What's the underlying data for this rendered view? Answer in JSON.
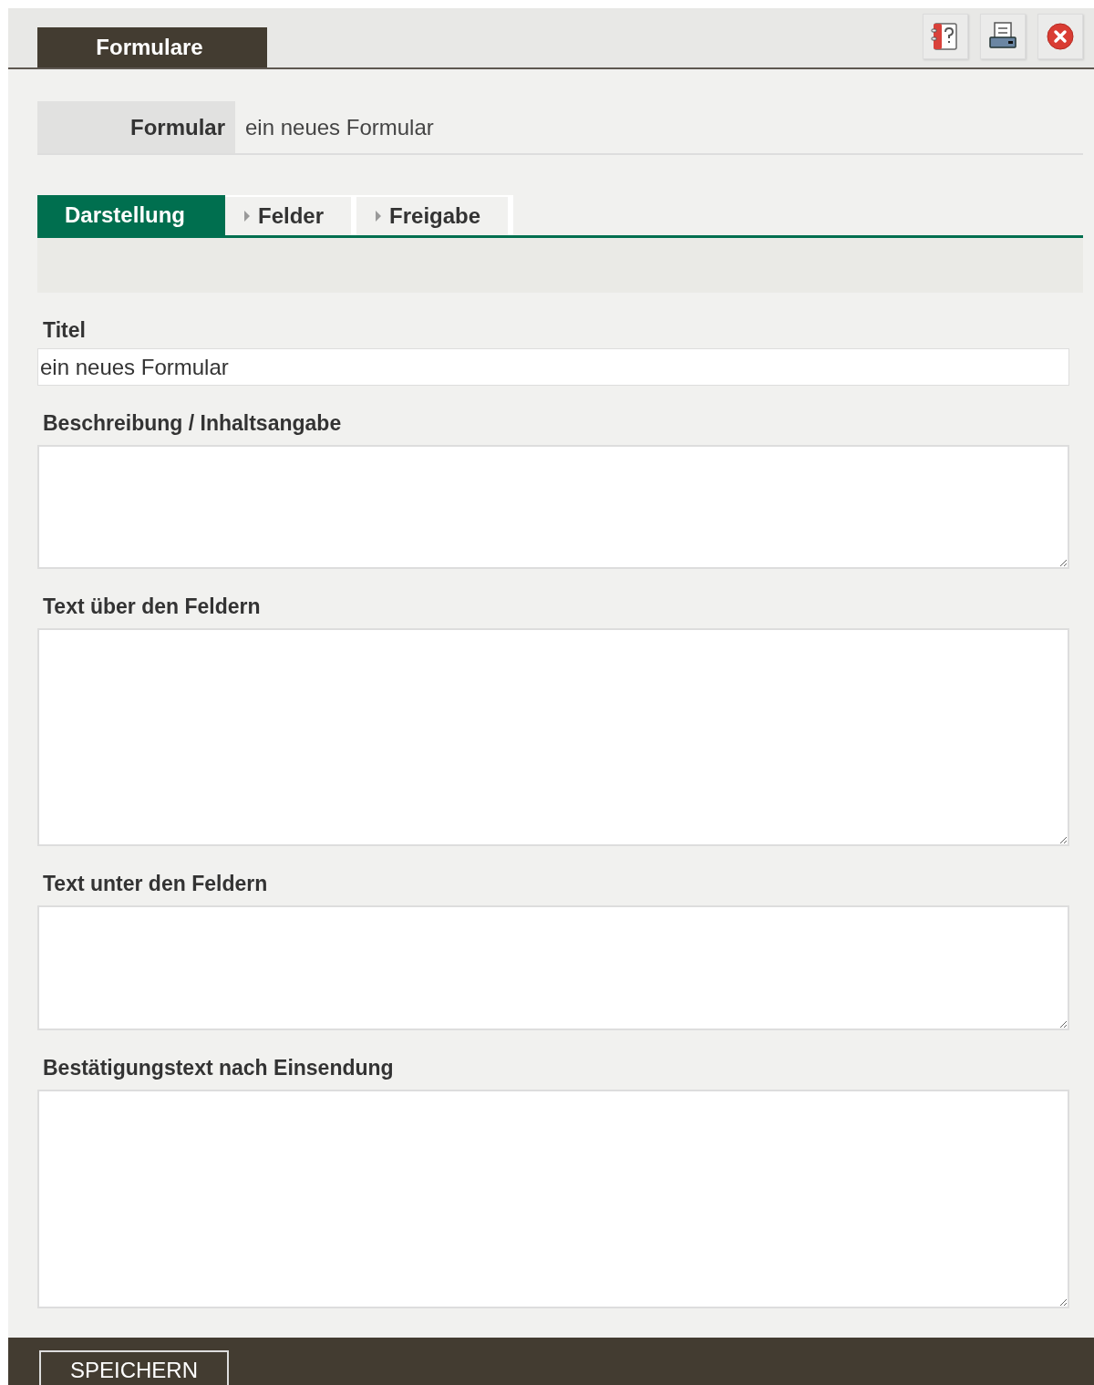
{
  "window": {
    "title": "Formulare"
  },
  "toolbar": [
    {
      "kind": "help"
    },
    {
      "kind": "print"
    },
    {
      "kind": "close"
    }
  ],
  "record": {
    "label": "Formular",
    "value": "ein neues Formular"
  },
  "tabs": [
    {
      "label": "Darstellung",
      "selected": true
    },
    {
      "label": "Felder",
      "selected": false
    },
    {
      "label": "Freigabe",
      "selected": false
    }
  ],
  "fields": [
    {
      "kind": "input",
      "label": "Titel",
      "value": "ein neues Formular"
    },
    {
      "kind": "textarea",
      "label": "Beschreibung / Inhaltsangabe"
    },
    {
      "kind": "textarea",
      "label": "Text über den Feldern"
    },
    {
      "kind": "textarea",
      "label": "Text unter den Feldern"
    },
    {
      "kind": "textarea",
      "label": "Bestätigungstext nach Einsendung"
    }
  ],
  "footer": {
    "button": "SPEICHERN"
  }
}
